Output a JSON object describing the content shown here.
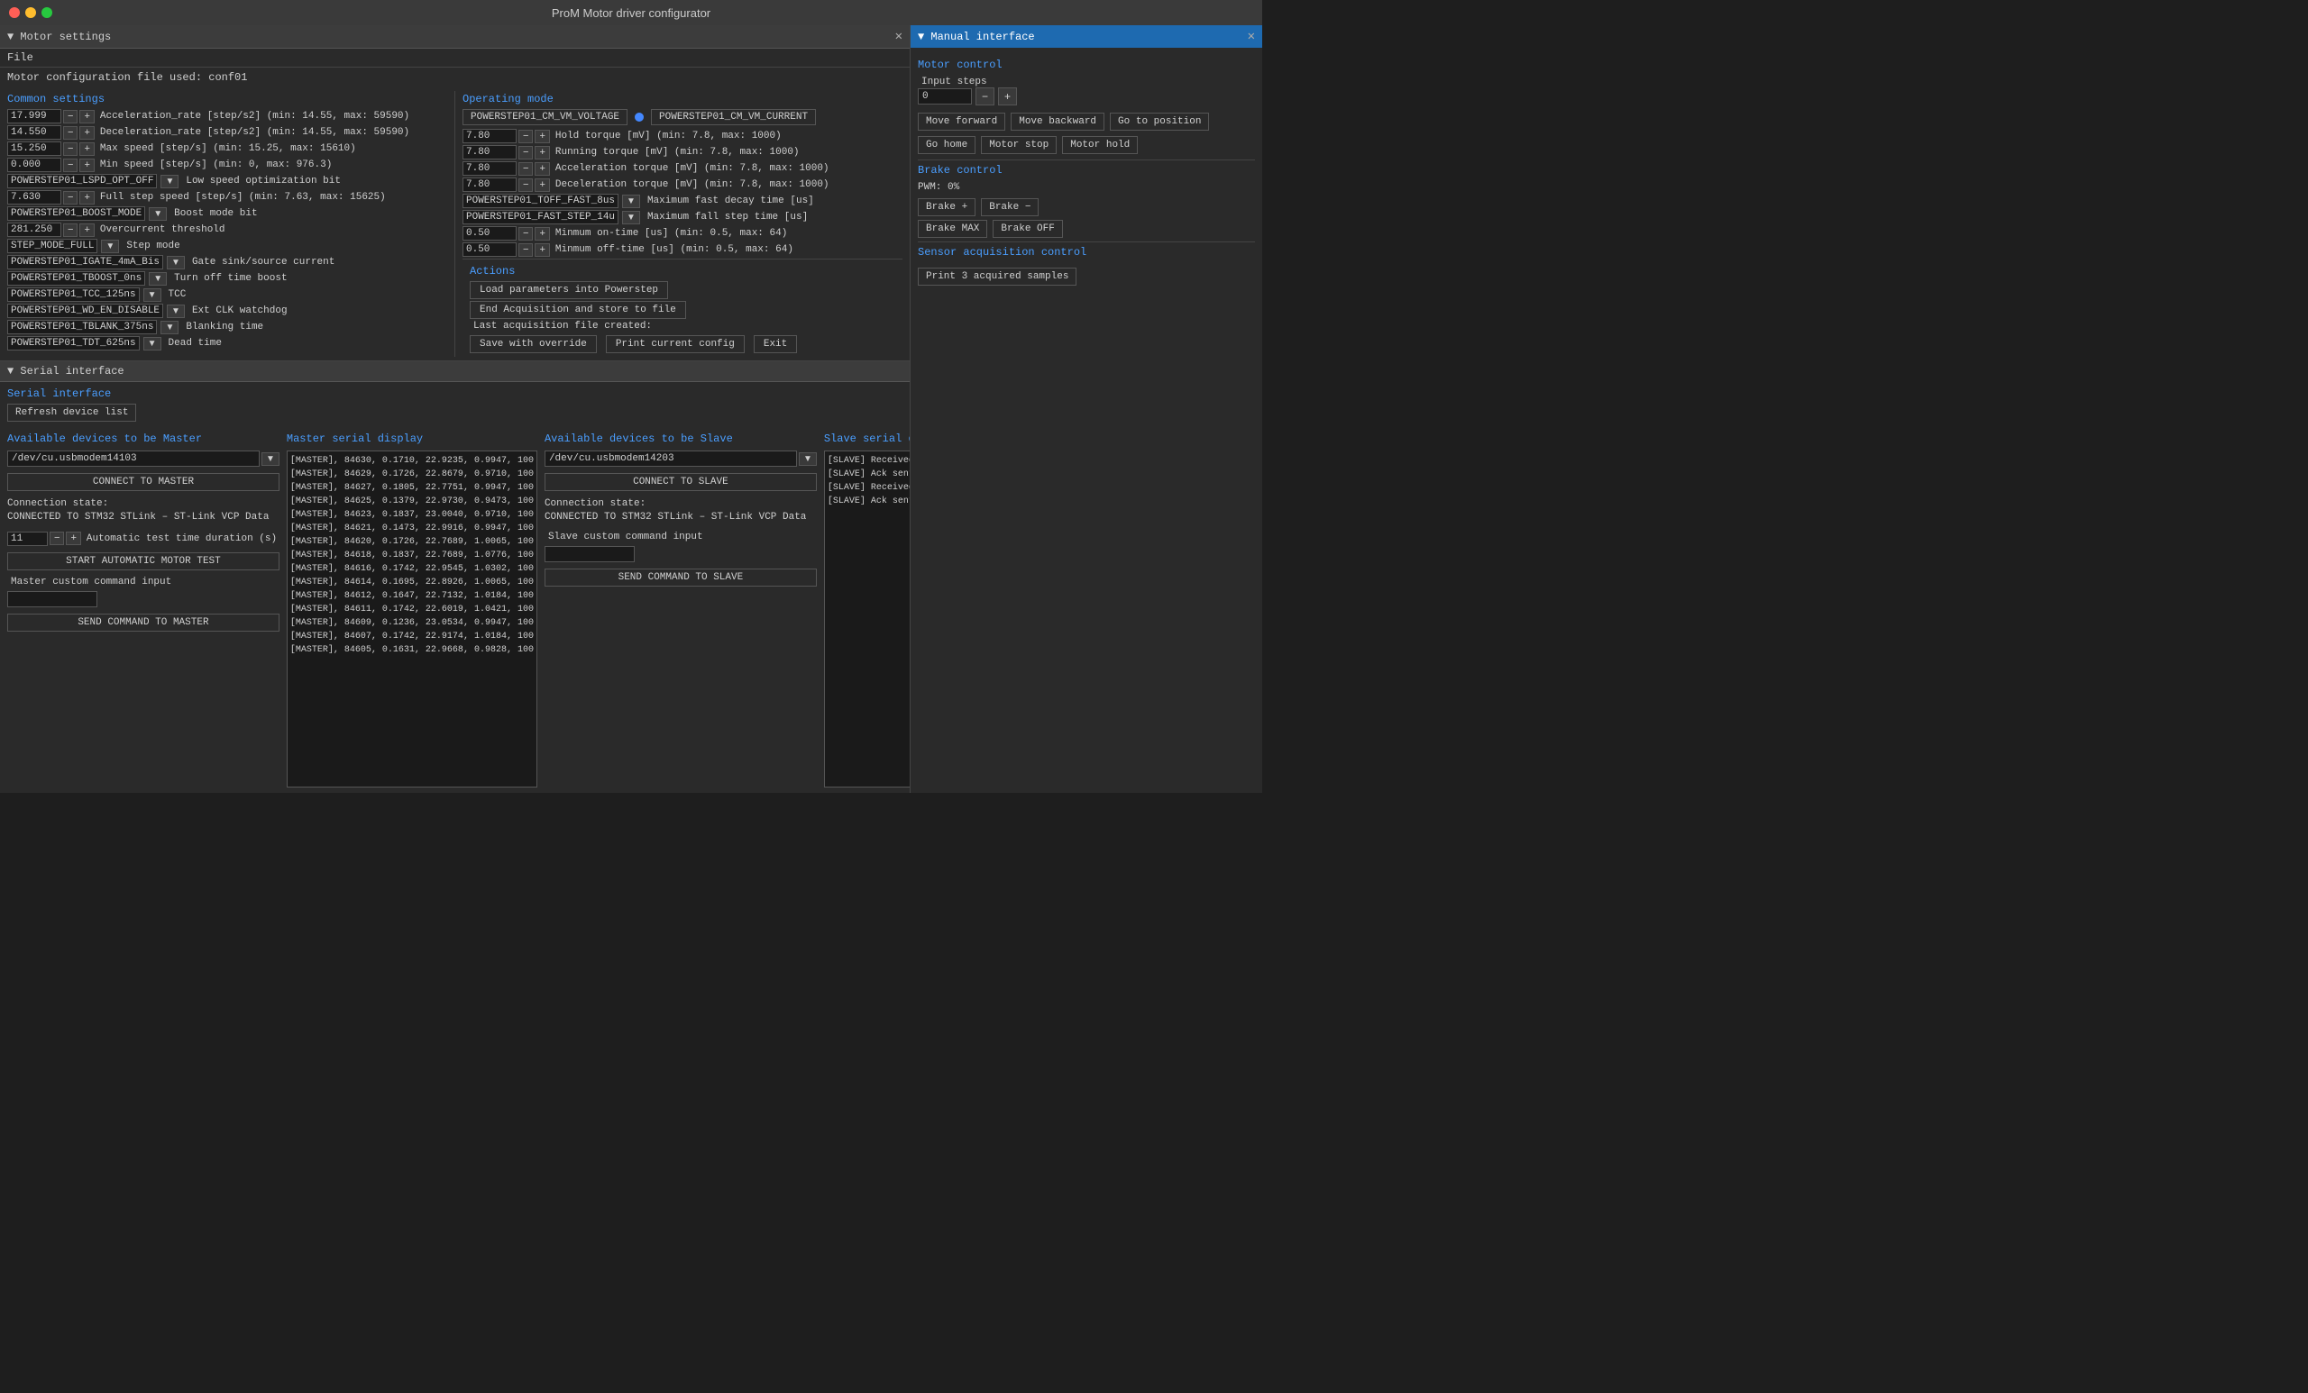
{
  "app": {
    "title": "ProM Motor driver configurator"
  },
  "motor_settings": {
    "section_title": "▼ Motor settings",
    "file_menu": "File",
    "config_file": "Motor configuration file used: conf01",
    "common_settings_label": "Common settings",
    "params": [
      {
        "value": "17.999",
        "label": "Acceleration_rate [step/s2] (min: 14.55, max: 59590)"
      },
      {
        "value": "14.550",
        "label": "Deceleration_rate [step/s2] (min: 14.55, max: 59590)"
      },
      {
        "value": "15.250",
        "label": "Max speed [step/s] (min: 15.25, max: 15610)"
      },
      {
        "value": "0.000",
        "label": "Min speed [step/s] (min: 0, max: 976.3)"
      },
      {
        "value": "7.630",
        "label": "Full step speed [step/s] (min: 7.63, max: 15625)"
      },
      {
        "value": "281.250",
        "label": "Overcurrent threshold"
      }
    ],
    "dropdowns": [
      {
        "value": "POWERSTEP01_LSPD_OPT_OFF",
        "label": "Low speed optimization bit"
      },
      {
        "value": "POWERSTEP01_BOOST_MODE",
        "label": "Boost mode bit"
      },
      {
        "value": "STEP_MODE_FULL",
        "label": "Step mode"
      },
      {
        "value": "POWERSTEP01_IGATE_4mA_Bis",
        "label": "Gate sink/source current"
      },
      {
        "value": "POWERSTEP01_TBOOST_0ns",
        "label": "Turn off time boost"
      },
      {
        "value": "POWERSTEP01_TCC_125ns",
        "label": "TCC"
      },
      {
        "value": "POWERSTEP01_WD_EN_DISABLE",
        "label": "Ext CLK watchdog"
      },
      {
        "value": "POWERSTEP01_TBLANK_375ns",
        "label": "Blanking time"
      },
      {
        "value": "POWERSTEP01_TDT_625ns",
        "label": "Dead time"
      }
    ],
    "operating_mode_label": "Operating mode",
    "mode_voltage": "POWERSTEP01_CM_VM_VOLTAGE",
    "mode_current": "POWERSTEP01_CM_VM_CURRENT",
    "op_params": [
      {
        "value": "7.80",
        "label": "Hold torque [mV] (min: 7.8, max: 1000)"
      },
      {
        "value": "7.80",
        "label": "Running torque [mV] (min: 7.8, max: 1000)"
      },
      {
        "value": "7.80",
        "label": "Acceleration torque [mV] (min: 7.8, max: 1000)"
      },
      {
        "value": "7.80",
        "label": "Deceleration torque [mV] (min: 7.8, max: 1000)"
      },
      {
        "value": "0.50",
        "label": "Minmum on-time [us] (min: 0.5, max: 64)"
      },
      {
        "value": "0.50",
        "label": "Minmum off-time [us] (min: 0.5, max: 64)"
      }
    ],
    "op_dropdowns": [
      {
        "value": "POWERSTEP01_TOFF_FAST_8us",
        "label": "Maximum fast decay time [us]"
      },
      {
        "value": "POWERSTEP01_FAST_STEP_14u",
        "label": "Maximum fall step time [us]"
      }
    ],
    "actions_label": "Actions",
    "load_btn": "Load parameters into Powerstep",
    "end_acquisition_btn": "End Acquisition and store to file",
    "last_acq_label": "Last acquisition file created:",
    "last_acq_value": "",
    "save_btn": "Save with override",
    "print_btn": "Print current config",
    "exit_btn": "Exit"
  },
  "serial_interface": {
    "section_title": "▼ Serial interface",
    "label": "Serial interface",
    "refresh_btn": "Refresh device list",
    "master_label": "Available devices to be Master",
    "master_device": "/dev/cu.usbmodem14103",
    "connect_master_btn": "CONNECT TO MASTER",
    "master_connection_label": "Connection state:",
    "master_connection_state": "CONNECTED TO STM32 STLink – ST-Link VCP Data",
    "auto_test_label": "Automatic test time duration (s)",
    "auto_test_value": "11",
    "start_auto_test_btn": "START AUTOMATIC MOTOR TEST",
    "master_custom_label": "Master custom command input",
    "master_custom_value": "",
    "send_master_btn": "SEND COMMAND TO MASTER",
    "master_display_label": "Master serial display",
    "master_display_lines": [
      "[MASTER], 84630, 0.1710, 22.9235, 0.9947, 100",
      "[MASTER], 84629, 0.1726, 22.8679, 0.9710, 100",
      "[MASTER], 84627, 0.1805, 22.7751, 0.9947, 100",
      "[MASTER], 84625, 0.1379, 22.9730, 0.9473, 100",
      "[MASTER], 84623, 0.1837, 23.0040, 0.9710, 100",
      "[MASTER], 84621, 0.1473, 22.9916, 0.9947, 100",
      "[MASTER], 84620, 0.1726, 22.7689, 1.0065, 100",
      "[MASTER], 84618, 0.1837, 22.7689, 1.0776, 100",
      "[MASTER], 84616, 0.1742, 22.9545, 1.0302, 100",
      "[MASTER], 84614, 0.1695, 22.8926, 1.0065, 100",
      "[MASTER], 84612, 0.1647, 22.7132, 1.0184, 100",
      "[MASTER], 84611, 0.1742, 22.6019, 1.0421, 100",
      "[MASTER], 84609, 0.1236, 23.0534, 0.9947, 100",
      "[MASTER], 84607, 0.1742, 22.9174, 1.0184, 100",
      "[MASTER], 84605, 0.1631, 22.9668, 0.9828, 100"
    ],
    "slave_label": "Available devices to be Slave",
    "slave_device": "/dev/cu.usbmodem14203",
    "connect_slave_btn": "CONNECT TO SLAVE",
    "slave_connection_label": "Connection state:",
    "slave_connection_state": "CONNECTED TO STM32 STLink – ST-Link VCP Data",
    "slave_custom_label": "Slave custom command input",
    "slave_custom_value": "",
    "send_slave_btn": "SEND COMMAND TO SLAVE",
    "slave_display_label": "Slave serial display",
    "slave_display_lines": [
      "[SLAVE] Received start command, sending ac",
      "[SLAVE] Ack sent, starting the motor",
      "[SLAVE] Received stop command, sending ack",
      "[SLAVE] Ack sent, stopping the motor"
    ]
  },
  "manual_interface": {
    "section_title": "▼ Manual interface",
    "motor_control_label": "Motor control",
    "input_steps_label": "Input steps",
    "steps_value": "0",
    "minus_btn": "−",
    "plus_btn": "+",
    "move_forward_btn": "Move forward",
    "move_backward_btn": "Move backward",
    "go_to_position_btn": "Go to position",
    "go_home_btn": "Go home",
    "motor_stop_btn": "Motor stop",
    "motor_hold_btn": "Motor hold",
    "brake_control_label": "Brake control",
    "pwm_label": "PWM: 0%",
    "brake_plus_btn": "Brake +",
    "brake_minus_btn": "Brake −",
    "brake_max_btn": "Brake MAX",
    "brake_off_btn": "Brake OFF",
    "sensor_label": "Sensor acquisition control",
    "print_samples_btn": "Print 3 acquired samples"
  }
}
